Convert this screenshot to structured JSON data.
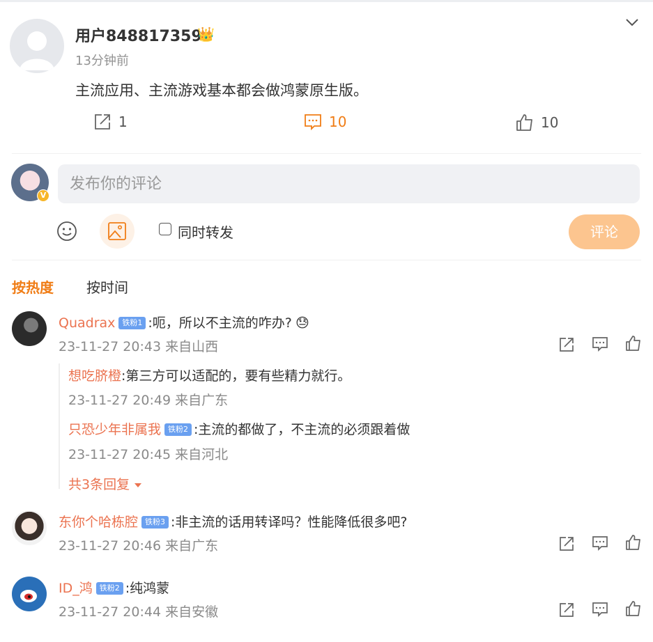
{
  "post": {
    "author": "用户848817359",
    "time": "13分钟前",
    "text": "主流应用、主流游戏基本都会做鸿蒙原生版。",
    "repost_count": "1",
    "comment_count": "10",
    "like_count": "10",
    "crown_icon": "👑"
  },
  "composer": {
    "placeholder": "发布你的评论",
    "repost_label": "同时转发",
    "submit_label": "评论",
    "badge": "V"
  },
  "sort": {
    "hot": "按热度",
    "time": "按时间"
  },
  "comments": [
    {
      "name": "Quadrax",
      "fan": "铁粉1",
      "text": ":呃，所以不主流的咋办?",
      "emoji": "😓",
      "meta": "23-11-27 20:43 来自山西"
    },
    {
      "name": "东你个哈栋腔",
      "fan": "铁粉3",
      "text": ":非主流的话用转译吗？性能降低很多吧?",
      "meta": "23-11-27 20:46 来自广东"
    },
    {
      "name": "ID_鸿",
      "fan": "铁粉2",
      "text": ":纯鸿蒙",
      "meta": "23-11-27 20:44 来自安徽"
    }
  ],
  "replies": [
    {
      "name": "想吃脐橙",
      "text": ":第三方可以适配的，要有些精力就行。",
      "meta": "23-11-27 20:49 来自广东"
    },
    {
      "name": "只恐少年非属我",
      "fan": "铁粉2",
      "text": ":主流的都做了，不主流的必须跟着做",
      "meta": "23-11-27 20:45 来自河北"
    }
  ],
  "more_replies": "共3条回复",
  "colors": {
    "accent": "#f07d16",
    "name": "#eb7350",
    "submit": "#fcc58f"
  }
}
